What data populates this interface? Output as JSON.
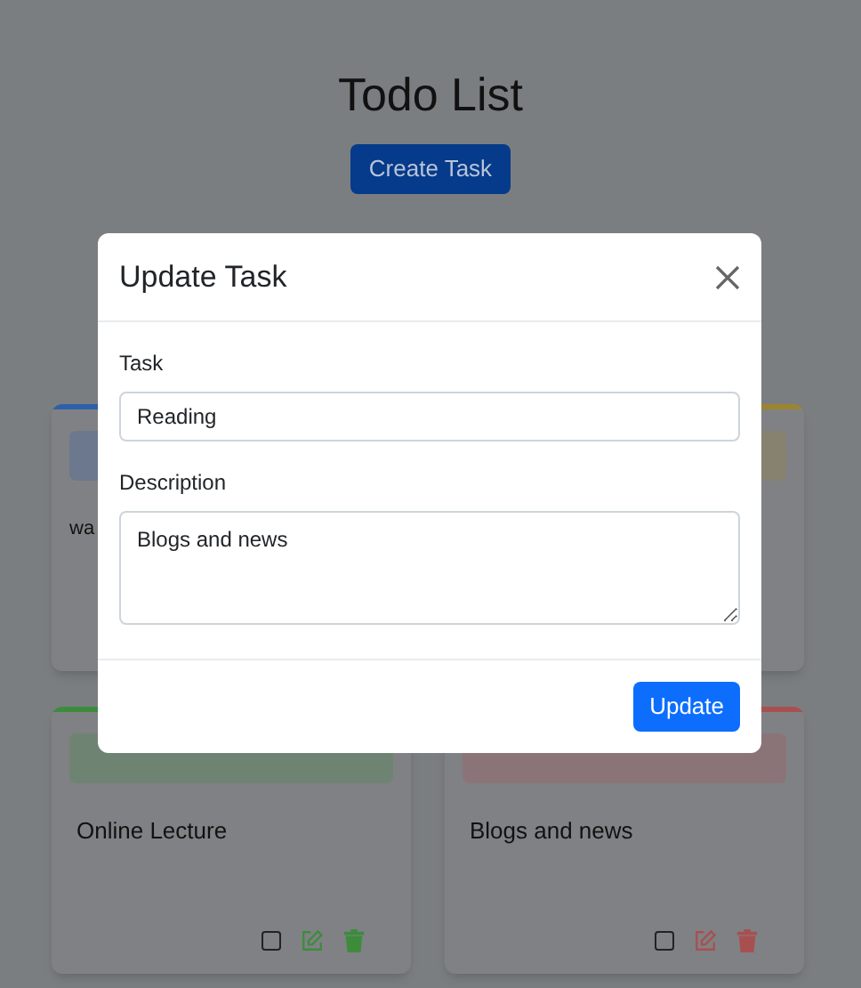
{
  "page": {
    "title": "Todo List",
    "create_button": "Create Task"
  },
  "cards": [
    {
      "color": "#2f5fa8",
      "description": "wa"
    },
    {
      "color": "#9c8530"
    },
    {
      "color": "#3c8c3c",
      "description": "Online Lecture",
      "checked": false
    },
    {
      "color": "#a85050",
      "description": "Blogs and news",
      "checked": false
    }
  ],
  "modal": {
    "title": "Update Task",
    "fields": [
      {
        "kind": "input",
        "label": "Task",
        "value": "Reading"
      },
      {
        "kind": "textarea",
        "label": "Description",
        "value": "Blogs and news"
      }
    ],
    "submit": "Update"
  }
}
